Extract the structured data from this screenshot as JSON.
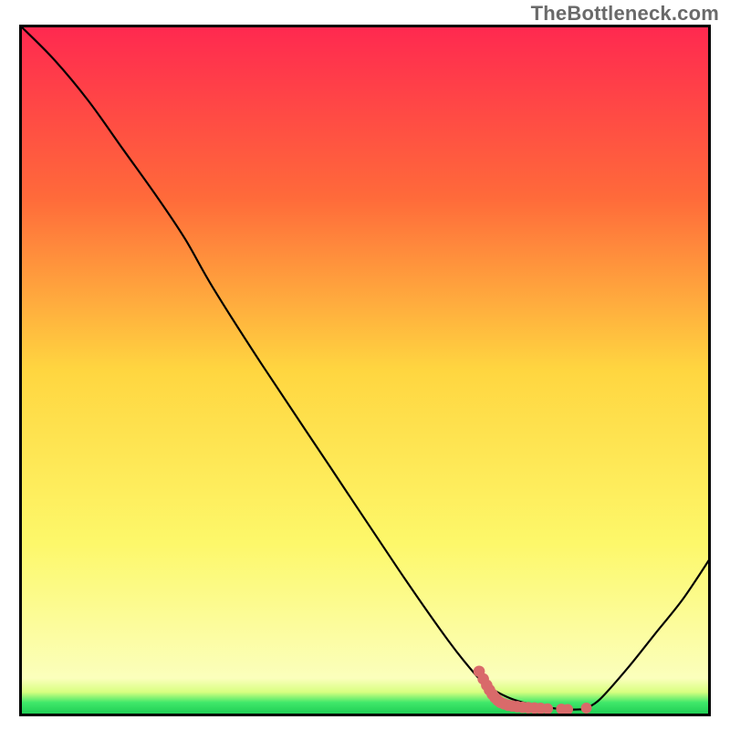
{
  "attribution": "TheBottleneck.com",
  "chart_data": {
    "type": "line",
    "title": "",
    "xlabel": "",
    "ylabel": "",
    "xlim": [
      0,
      100
    ],
    "ylim": [
      0,
      100
    ],
    "grid": false,
    "legend": false,
    "background_gradient_stops": [
      {
        "offset": 0.0,
        "color": "#ff2850"
      },
      {
        "offset": 0.25,
        "color": "#ff6a3a"
      },
      {
        "offset": 0.5,
        "color": "#ffd640"
      },
      {
        "offset": 0.75,
        "color": "#fdf86a"
      },
      {
        "offset": 0.945,
        "color": "#fbffbc"
      },
      {
        "offset": 0.965,
        "color": "#d8ff80"
      },
      {
        "offset": 0.98,
        "color": "#40e86a"
      },
      {
        "offset": 1.0,
        "color": "#18c850"
      }
    ],
    "series": [
      {
        "name": "curve",
        "x": [
          0,
          5,
          10,
          15,
          20,
          24,
          28,
          35,
          45,
          55,
          62,
          66,
          68,
          71,
          74,
          77,
          79,
          81,
          82,
          84,
          88,
          92,
          96,
          100
        ],
        "y": [
          100,
          95,
          89,
          82,
          75,
          69,
          62,
          51,
          36,
          21,
          11,
          6,
          4.2,
          2.6,
          1.7,
          1.2,
          1.0,
          1.0,
          1.2,
          2.5,
          7.0,
          12,
          17,
          23
        ]
      }
    ],
    "markers": [
      {
        "x": 66.5,
        "y": 6.5,
        "r": 1.0,
        "color": "#d96a6a"
      },
      {
        "x": 67.1,
        "y": 5.4,
        "r": 1.0,
        "color": "#d96a6a"
      },
      {
        "x": 67.6,
        "y": 4.5,
        "r": 1.0,
        "color": "#d96a6a"
      },
      {
        "x": 68.0,
        "y": 3.8,
        "r": 1.0,
        "color": "#d96a6a"
      },
      {
        "x": 68.4,
        "y": 3.2,
        "r": 1.0,
        "color": "#d96a6a"
      },
      {
        "x": 68.8,
        "y": 2.7,
        "r": 1.0,
        "color": "#d96a6a"
      },
      {
        "x": 69.2,
        "y": 2.3,
        "r": 1.0,
        "color": "#d96a6a"
      },
      {
        "x": 69.6,
        "y": 2.0,
        "r": 1.0,
        "color": "#d96a6a"
      },
      {
        "x": 70.1,
        "y": 1.8,
        "r": 1.0,
        "color": "#d96a6a"
      },
      {
        "x": 70.7,
        "y": 1.6,
        "r": 1.0,
        "color": "#d96a6a"
      },
      {
        "x": 71.3,
        "y": 1.5,
        "r": 1.0,
        "color": "#d96a6a"
      },
      {
        "x": 72.0,
        "y": 1.4,
        "r": 1.0,
        "color": "#d96a6a"
      },
      {
        "x": 72.8,
        "y": 1.3,
        "r": 1.0,
        "color": "#d96a6a"
      },
      {
        "x": 73.6,
        "y": 1.25,
        "r": 1.0,
        "color": "#d96a6a"
      },
      {
        "x": 74.5,
        "y": 1.2,
        "r": 1.0,
        "color": "#d96a6a"
      },
      {
        "x": 75.4,
        "y": 1.15,
        "r": 1.0,
        "color": "#d96a6a"
      },
      {
        "x": 76.4,
        "y": 1.1,
        "r": 0.9,
        "color": "#d96a6a"
      },
      {
        "x": 78.4,
        "y": 1.05,
        "r": 0.9,
        "color": "#d96a6a"
      },
      {
        "x": 79.3,
        "y": 1.0,
        "r": 0.9,
        "color": "#d96a6a"
      },
      {
        "x": 82.0,
        "y": 1.2,
        "r": 0.9,
        "color": "#d96a6a"
      }
    ],
    "frame_color": "#000000",
    "frame_width": 3,
    "curve_color": "#000000",
    "curve_width": 2.2
  }
}
